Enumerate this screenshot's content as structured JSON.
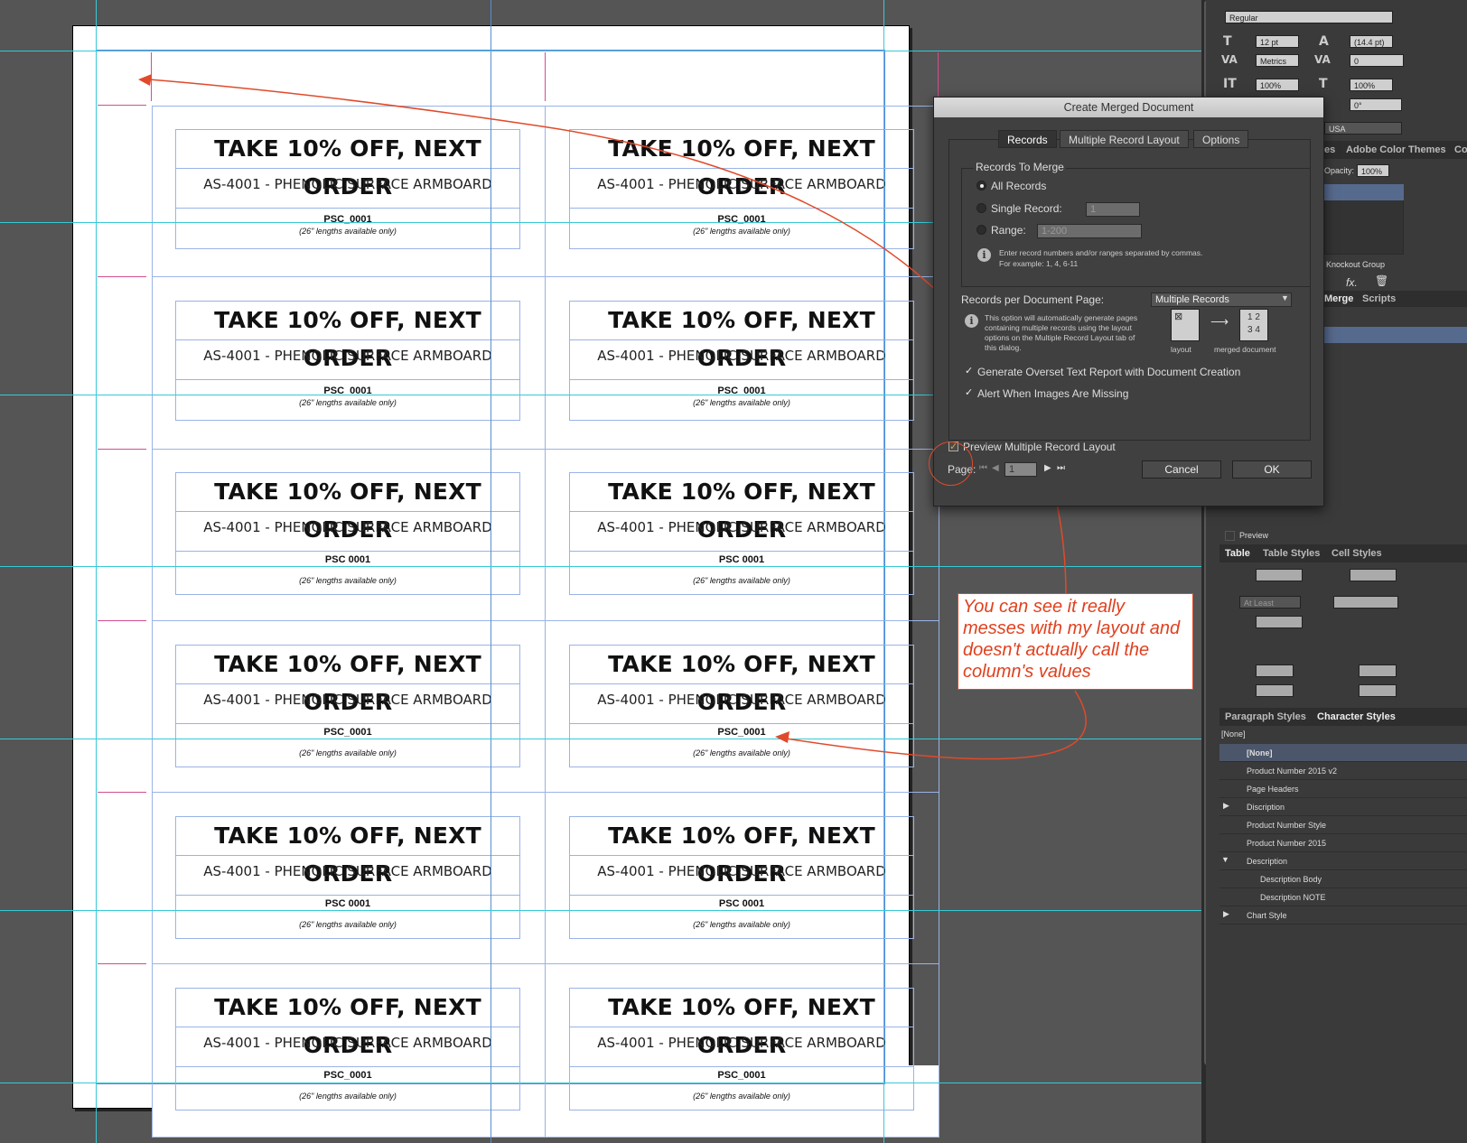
{
  "dialog": {
    "title": "Create Merged Document",
    "tabs": [
      "Records",
      "Multiple Record Layout",
      "Options"
    ],
    "group_title": "Records To Merge",
    "all_records": "All Records",
    "single_record": "Single Record:",
    "single_value": "1",
    "range": "Range:",
    "range_value": "1-200",
    "range_help": "Enter record numbers and/or ranges separated by commas. For example: 1, 4, 6-11",
    "per_page_label": "Records per Document Page:",
    "per_page_value": "Multiple Records",
    "per_page_help": "This option will automatically generate pages containing multiple records using the layout options on the Multiple Record Layout tab of this dialog.",
    "layout_caption": "layout",
    "merged_caption": "merged document",
    "overset_label": "Generate Overset Text Report with Document Creation",
    "alert_label": "Alert When Images Are Missing",
    "preview_label": "Preview Multiple Record Layout",
    "page_label": "Page:",
    "page_value": "1",
    "cancel": "Cancel",
    "ok": "OK"
  },
  "cards": {
    "headline": "TAKE 10% OFF, NEXT ORDER",
    "product": "AS-4001 - PHENOLIC SURFACE ARMBOARD",
    "code": "PSC_0001",
    "code_alt": "PSC 0001",
    "note": "(26\" lengths available only)"
  },
  "callout": {
    "text": "You can see it really messes with my layout and doesn't actually call the column's values"
  },
  "panel": {
    "font_style": "Regular",
    "size": "12 pt",
    "leading": "(14.4 pt)",
    "kerning": "Metrics",
    "tracking": "0",
    "vscale": "100%",
    "hscale": "100%",
    "skew": "0°",
    "language": "USA",
    "tabs_top": [
      "es",
      "Adobe Color Themes",
      "Co"
    ],
    "opacity_label": "Opacity:",
    "opacity": "100%",
    "knockout": "Knockout Group",
    "fx": "fx.",
    "merge_tab": "Merge",
    "scripts_tab": "Scripts",
    "preview": "Preview",
    "table_tabs": [
      "Table",
      "Table Styles",
      "Cell Styles"
    ],
    "at_least": "At Least",
    "style_tabs": [
      "Paragraph Styles",
      "Character Styles"
    ],
    "current_style": "[None]",
    "styles": [
      "[None]",
      "Product Number 2015 v2",
      "Page Headers",
      "Discription",
      "Product Number Style",
      "Product Number 2015",
      "Description",
      "Description Body",
      "Description NOTE",
      "Chart Style"
    ]
  }
}
